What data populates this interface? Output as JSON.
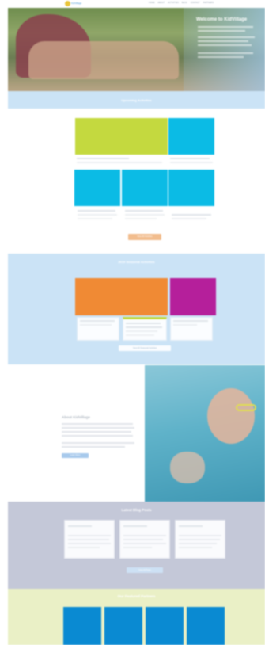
{
  "header": {
    "logo_text": "KidVillage",
    "nav": [
      "HOME",
      "ABOUT",
      "ACTIVITIES",
      "BLOG",
      "CONTACT",
      "PARTNERS"
    ]
  },
  "hero": {
    "title": "Welcome to KidVillage"
  },
  "upcoming": {
    "title": "Upcoming Activities",
    "button_label": "View All Activities",
    "colors": {
      "lime": "#c4d93f",
      "cyan": "#0bbbe5"
    }
  },
  "season": {
    "title": "2019 Seasonal Activities",
    "button_label": "View All Seasonal Activities",
    "colors": {
      "orange": "#f08a34",
      "magenta": "#b51f9b"
    }
  },
  "about": {
    "title": "About KidVillage",
    "button_label": "Learn More",
    "image_colors": {
      "water": "#5fb2c9",
      "goggle": "#e0dc53"
    }
  },
  "blog": {
    "title": "Latest Blog Posts",
    "button_label": "View All Posts"
  },
  "partners": {
    "title": "Our Featured Partners",
    "color": "#0a8ad2"
  }
}
